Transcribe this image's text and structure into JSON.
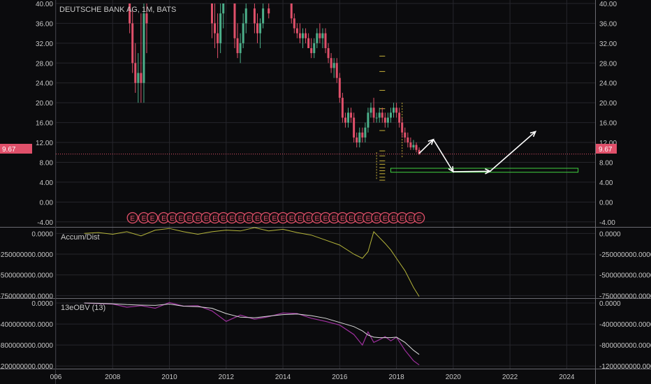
{
  "colors": {
    "background": "#0b0b0d",
    "grid": "#26262c",
    "axis_text": "#c8c8c8",
    "candle_up": "#4caf8a",
    "candle_down": "#e0506a",
    "price_line": "#e0506a",
    "accum": "#b5b53a",
    "obv": "#a030a0",
    "obv_signal": "#dcdcdc",
    "green_box": "#40d040",
    "arrow": "#ffffff",
    "earnings": "#e0506a",
    "fib": "#c9b23a"
  },
  "main_panel": {
    "title": "DEUTSCHE BANK AG, 1M, BATS",
    "y_ticks": [
      "40.00",
      "36.00",
      "32.00",
      "28.00",
      "24.00",
      "20.00",
      "16.00",
      "12.00",
      "8.00",
      "4.00",
      "0.00",
      "-4.00"
    ],
    "current_price_label": "9.67",
    "earnings_marker_label": "E"
  },
  "accum_panel": {
    "title": "Accum/Dist",
    "y_ticks": [
      "0.0000",
      "-250000000.0000",
      "-500000000.0000",
      "-750000000.0000"
    ]
  },
  "obv_panel": {
    "title": "13eOBV (13)",
    "y_ticks": [
      "0.0000",
      "-400000000.0000",
      "-800000000.0000",
      "-1200000000.0000"
    ]
  },
  "x_axis": {
    "labels": [
      "006",
      "2008",
      "2010",
      "2012",
      "2014",
      "2016",
      "2018",
      "2020",
      "2022",
      "2024"
    ]
  },
  "chart_data": [
    {
      "type": "candlestick",
      "title": "DEUTSCHE BANK AG, 1M, BATS",
      "ylim": [
        -6,
        40
      ],
      "last_price": 9.67,
      "x_range": [
        2006.0,
        2025.0
      ],
      "candles": [
        {
          "t": 2008.6,
          "o": 40,
          "h": 40,
          "l": 34,
          "c": 36
        },
        {
          "t": 2008.7,
          "o": 36,
          "h": 39,
          "l": 26,
          "c": 28
        },
        {
          "t": 2008.8,
          "o": 28,
          "h": 32,
          "l": 22,
          "c": 24
        },
        {
          "t": 2008.9,
          "o": 24,
          "h": 30,
          "l": 20,
          "c": 26
        },
        {
          "t": 2009.0,
          "o": 26,
          "h": 38,
          "l": 20,
          "c": 24
        },
        {
          "t": 2009.1,
          "o": 24,
          "h": 40,
          "l": 20,
          "c": 38
        },
        {
          "t": 2009.2,
          "o": 38,
          "h": 40,
          "l": 30,
          "c": 36
        },
        {
          "t": 2011.5,
          "o": 40,
          "h": 40,
          "l": 33,
          "c": 36
        },
        {
          "t": 2011.6,
          "o": 36,
          "h": 40,
          "l": 31,
          "c": 34
        },
        {
          "t": 2011.7,
          "o": 34,
          "h": 38,
          "l": 29,
          "c": 32
        },
        {
          "t": 2011.8,
          "o": 32,
          "h": 40,
          "l": 30,
          "c": 38
        },
        {
          "t": 2011.9,
          "o": 38,
          "h": 40,
          "l": 35,
          "c": 40
        },
        {
          "t": 2012.3,
          "o": 40,
          "h": 40,
          "l": 31,
          "c": 33
        },
        {
          "t": 2012.4,
          "o": 33,
          "h": 36,
          "l": 29,
          "c": 30
        },
        {
          "t": 2012.5,
          "o": 30,
          "h": 34,
          "l": 28,
          "c": 32
        },
        {
          "t": 2012.6,
          "o": 32,
          "h": 38,
          "l": 31,
          "c": 36
        },
        {
          "t": 2012.7,
          "o": 36,
          "h": 40,
          "l": 34,
          "c": 39
        },
        {
          "t": 2013.0,
          "o": 39,
          "h": 40,
          "l": 34,
          "c": 36
        },
        {
          "t": 2013.1,
          "o": 36,
          "h": 38,
          "l": 32,
          "c": 34
        },
        {
          "t": 2013.2,
          "o": 34,
          "h": 37,
          "l": 31,
          "c": 36
        },
        {
          "t": 2013.3,
          "o": 36,
          "h": 40,
          "l": 35,
          "c": 39
        },
        {
          "t": 2013.5,
          "o": 39,
          "h": 40,
          "l": 37,
          "c": 38
        },
        {
          "t": 2014.3,
          "o": 40,
          "h": 40,
          "l": 36,
          "c": 37
        },
        {
          "t": 2014.4,
          "o": 37,
          "h": 38,
          "l": 34,
          "c": 35
        },
        {
          "t": 2014.5,
          "o": 35,
          "h": 36,
          "l": 33,
          "c": 34
        },
        {
          "t": 2014.6,
          "o": 34,
          "h": 36,
          "l": 32,
          "c": 33
        },
        {
          "t": 2014.7,
          "o": 33,
          "h": 35,
          "l": 31,
          "c": 34
        },
        {
          "t": 2014.8,
          "o": 34,
          "h": 35,
          "l": 32,
          "c": 33
        },
        {
          "t": 2014.9,
          "o": 33,
          "h": 34,
          "l": 31,
          "c": 31
        },
        {
          "t": 2015.0,
          "o": 31,
          "h": 33,
          "l": 29,
          "c": 30
        },
        {
          "t": 2015.1,
          "o": 30,
          "h": 33,
          "l": 29,
          "c": 32
        },
        {
          "t": 2015.2,
          "o": 32,
          "h": 35,
          "l": 31,
          "c": 34
        },
        {
          "t": 2015.3,
          "o": 34,
          "h": 36,
          "l": 32,
          "c": 33
        },
        {
          "t": 2015.4,
          "o": 33,
          "h": 35,
          "l": 31,
          "c": 34
        },
        {
          "t": 2015.5,
          "o": 34,
          "h": 35,
          "l": 30,
          "c": 31
        },
        {
          "t": 2015.6,
          "o": 31,
          "h": 32,
          "l": 28,
          "c": 29
        },
        {
          "t": 2015.7,
          "o": 29,
          "h": 30,
          "l": 26,
          "c": 27
        },
        {
          "t": 2015.8,
          "o": 27,
          "h": 29,
          "l": 25,
          "c": 28
        },
        {
          "t": 2015.9,
          "o": 28,
          "h": 29,
          "l": 24,
          "c": 25
        },
        {
          "t": 2016.0,
          "o": 25,
          "h": 26,
          "l": 20,
          "c": 21
        },
        {
          "t": 2016.1,
          "o": 21,
          "h": 22,
          "l": 16,
          "c": 17
        },
        {
          "t": 2016.2,
          "o": 17,
          "h": 18,
          "l": 15,
          "c": 16
        },
        {
          "t": 2016.3,
          "o": 16,
          "h": 19,
          "l": 15,
          "c": 18
        },
        {
          "t": 2016.4,
          "o": 18,
          "h": 19,
          "l": 16,
          "c": 17
        },
        {
          "t": 2016.5,
          "o": 17,
          "h": 18,
          "l": 12,
          "c": 13
        },
        {
          "t": 2016.6,
          "o": 13,
          "h": 14,
          "l": 11,
          "c": 12
        },
        {
          "t": 2016.7,
          "o": 12,
          "h": 15,
          "l": 11,
          "c": 14
        },
        {
          "t": 2016.8,
          "o": 14,
          "h": 15,
          "l": 12,
          "c": 13
        },
        {
          "t": 2016.9,
          "o": 13,
          "h": 16,
          "l": 12,
          "c": 15
        },
        {
          "t": 2017.0,
          "o": 15,
          "h": 19,
          "l": 14,
          "c": 18
        },
        {
          "t": 2017.1,
          "o": 18,
          "h": 20,
          "l": 17,
          "c": 19
        },
        {
          "t": 2017.2,
          "o": 19,
          "h": 21,
          "l": 16,
          "c": 17
        },
        {
          "t": 2017.3,
          "o": 17,
          "h": 18,
          "l": 16,
          "c": 17
        },
        {
          "t": 2017.4,
          "o": 17,
          "h": 19,
          "l": 16,
          "c": 18
        },
        {
          "t": 2017.5,
          "o": 18,
          "h": 19,
          "l": 16,
          "c": 17
        },
        {
          "t": 2017.6,
          "o": 17,
          "h": 18,
          "l": 15,
          "c": 16
        },
        {
          "t": 2017.7,
          "o": 16,
          "h": 18,
          "l": 15,
          "c": 17
        },
        {
          "t": 2017.8,
          "o": 17,
          "h": 19,
          "l": 16,
          "c": 18
        },
        {
          "t": 2017.9,
          "o": 18,
          "h": 20,
          "l": 17,
          "c": 19
        },
        {
          "t": 2018.0,
          "o": 19,
          "h": 20,
          "l": 17,
          "c": 18
        },
        {
          "t": 2018.1,
          "o": 18,
          "h": 19,
          "l": 15,
          "c": 16
        },
        {
          "t": 2018.2,
          "o": 16,
          "h": 17,
          "l": 13,
          "c": 14
        },
        {
          "t": 2018.3,
          "o": 14,
          "h": 15,
          "l": 12,
          "c": 13
        },
        {
          "t": 2018.4,
          "o": 13,
          "h": 14,
          "l": 11,
          "c": 12
        },
        {
          "t": 2018.5,
          "o": 12,
          "h": 13,
          "l": 10.5,
          "c": 11
        },
        {
          "t": 2018.6,
          "o": 11,
          "h": 12.5,
          "l": 10.5,
          "c": 11.5
        },
        {
          "t": 2018.7,
          "o": 11.5,
          "h": 12,
          "l": 10,
          "c": 10.5
        },
        {
          "t": 2018.8,
          "o": 10.5,
          "h": 11,
          "l": 9.5,
          "c": 9.67
        }
      ],
      "support_zone": {
        "x0": 2017.8,
        "x1": 2024.4,
        "y0": 6.0,
        "y1": 6.8
      },
      "projection_path": [
        [
          2018.8,
          9.8
        ],
        [
          2019.3,
          12.6
        ],
        [
          2020.0,
          6.1
        ],
        [
          2021.3,
          6.2
        ],
        [
          2022.9,
          14.2
        ]
      ],
      "fib_levels": [
        29.4,
        26.3,
        22.5,
        18.8,
        14.4,
        10.3,
        9.3,
        8.3,
        7.6,
        6.9,
        6.3,
        5.7,
        5.0,
        4.4
      ],
      "earnings_markers_x": [
        2008.7,
        2009.1,
        2009.4,
        2009.8,
        2010.1,
        2010.4,
        2010.7,
        2011.0,
        2011.3,
        2011.6,
        2011.9,
        2012.2,
        2012.5,
        2012.8,
        2013.1,
        2013.4,
        2013.7,
        2014.0,
        2014.3,
        2014.6,
        2014.9,
        2015.2,
        2015.5,
        2015.8,
        2016.1,
        2016.4,
        2016.7,
        2017.0,
        2017.3,
        2017.6,
        2017.9,
        2018.2,
        2018.5,
        2018.8
      ]
    },
    {
      "type": "line",
      "title": "Accum/Dist",
      "ylim": [
        -780000000,
        70000000
      ],
      "x": [
        2007.0,
        2007.5,
        2008.0,
        2008.5,
        2009.0,
        2009.5,
        2010.0,
        2010.5,
        2011.0,
        2011.5,
        2012.0,
        2012.5,
        2013.0,
        2013.5,
        2014.0,
        2014.5,
        2015.0,
        2015.5,
        2016.0,
        2016.5,
        2016.8,
        2017.0,
        2017.2,
        2017.4,
        2017.6,
        2017.8,
        2018.0,
        2018.3,
        2018.6,
        2018.8
      ],
      "values": [
        0,
        10000000,
        -10000000,
        20000000,
        -30000000,
        40000000,
        60000000,
        20000000,
        -10000000,
        20000000,
        40000000,
        30000000,
        70000000,
        30000000,
        50000000,
        10000000,
        -20000000,
        -80000000,
        -140000000,
        -250000000,
        -300000000,
        -220000000,
        20000000,
        -50000000,
        -120000000,
        -200000000,
        -300000000,
        -450000000,
        -650000000,
        -760000000
      ]
    },
    {
      "type": "line",
      "title": "13eOBV (13)",
      "ylim": [
        -1250000000,
        80000000
      ],
      "x": [
        2007.0,
        2007.5,
        2008.0,
        2008.5,
        2009.0,
        2009.5,
        2010.0,
        2010.5,
        2011.0,
        2011.5,
        2012.0,
        2012.5,
        2013.0,
        2013.5,
        2014.0,
        2014.5,
        2015.0,
        2015.5,
        2016.0,
        2016.5,
        2016.8,
        2017.0,
        2017.2,
        2017.4,
        2017.6,
        2017.8,
        2018.0,
        2018.3,
        2018.6,
        2018.8
      ],
      "series": [
        {
          "values": [
            0,
            -10000000,
            -20000000,
            -80000000,
            -50000000,
            -100000000,
            10000000,
            -60000000,
            -50000000,
            -150000000,
            -350000000,
            -230000000,
            -310000000,
            -260000000,
            -190000000,
            -200000000,
            -290000000,
            -350000000,
            -420000000,
            -600000000,
            -800000000,
            -550000000,
            -750000000,
            -700000000,
            -640000000,
            -720000000,
            -650000000,
            -900000000,
            -1100000000,
            -1180000000
          ]
        },
        {
          "values": [
            0,
            -5000000,
            -15000000,
            -30000000,
            -40000000,
            -45000000,
            -20000000,
            -60000000,
            -70000000,
            -100000000,
            -200000000,
            -270000000,
            -280000000,
            -250000000,
            -220000000,
            -210000000,
            -240000000,
            -290000000,
            -370000000,
            -450000000,
            -530000000,
            -610000000,
            -650000000,
            -660000000,
            -660000000,
            -660000000,
            -650000000,
            -750000000,
            -900000000,
            -980000000
          ]
        }
      ]
    }
  ]
}
